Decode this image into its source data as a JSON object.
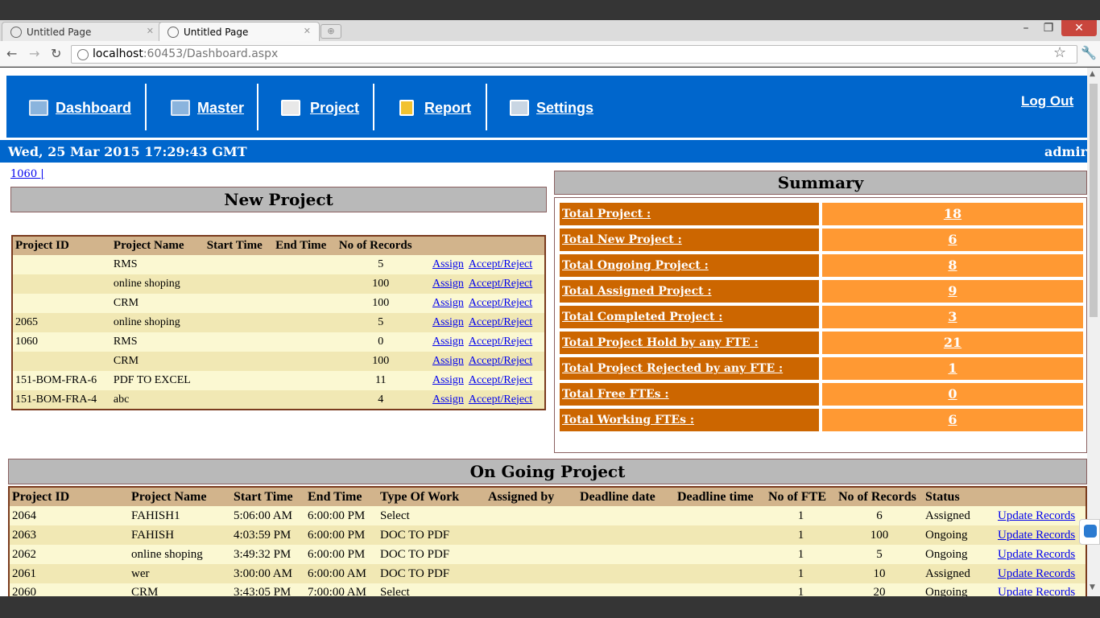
{
  "browser": {
    "tabs": [
      {
        "title": "Untitled Page",
        "active": false
      },
      {
        "title": "Untitled Page",
        "active": true
      }
    ],
    "url_host": "localhost",
    "url_rest": ":60453/Dashboard.aspx",
    "window_controls": {
      "minimize": "–",
      "restore": "❐",
      "close": "✕"
    }
  },
  "menu": {
    "items": [
      {
        "label": "Dashboard",
        "icon": "monitor-icon"
      },
      {
        "label": "Master",
        "icon": "monitor-icon"
      },
      {
        "label": "Project",
        "icon": "project-add-icon"
      },
      {
        "label": "Report",
        "icon": "bar-chart-icon"
      },
      {
        "label": "Settings",
        "icon": "gear-icon"
      }
    ],
    "logout": "Log Out"
  },
  "datebar": {
    "datetime": "Wed, 25 Mar 2015 17:29:43 GMT",
    "user": "admir"
  },
  "top_link": "1060 |",
  "new_project": {
    "title": "New Project",
    "columns": [
      "Project ID",
      "Project Name",
      "Start Time",
      "End Time",
      "No of Records",
      "",
      ""
    ],
    "rows": [
      [
        "",
        "RMS",
        "",
        "",
        "5",
        "Assign",
        "Accept/Reject"
      ],
      [
        "",
        "online shoping",
        "",
        "",
        "100",
        "Assign",
        "Accept/Reject"
      ],
      [
        "",
        "CRM",
        "",
        "",
        "100",
        "Assign",
        "Accept/Reject"
      ],
      [
        "2065",
        "online shoping",
        "",
        "",
        "5",
        "Assign",
        "Accept/Reject"
      ],
      [
        "1060",
        "RMS",
        "",
        "",
        "0",
        "Assign",
        "Accept/Reject"
      ],
      [
        "",
        "CRM",
        "",
        "",
        "100",
        "Assign",
        "Accept/Reject"
      ],
      [
        "151-BOM-FRA-6",
        "PDF TO EXCEL",
        "",
        "",
        "11",
        "Assign",
        "Accept/Reject"
      ],
      [
        "151-BOM-FRA-4",
        "abc",
        "",
        "",
        "4",
        "Assign",
        "Accept/Reject"
      ]
    ]
  },
  "summary": {
    "title": "Summary",
    "rows": [
      {
        "label": "Total Project :",
        "value": "18"
      },
      {
        "label": "Total New Project :",
        "value": "6"
      },
      {
        "label": "Total Ongoing Project :",
        "value": "8"
      },
      {
        "label": "Total Assigned Project :",
        "value": "9"
      },
      {
        "label": "Total Completed Project :",
        "value": "3"
      },
      {
        "label": "Total Project Hold by any FTE :",
        "value": "21"
      },
      {
        "label": "Total Project Rejected by any FTE :",
        "value": "1"
      },
      {
        "label": "Total Free FTEs :",
        "value": "0"
      },
      {
        "label": "Total Working FTEs :",
        "value": "6"
      }
    ]
  },
  "ongoing": {
    "title": "On Going Project",
    "columns": [
      "Project ID",
      "Project Name",
      "Start Time",
      "End Time",
      "Type Of Work",
      "Assigned by",
      "Deadline date",
      "Deadline time",
      "No of FTE",
      "No of Records",
      "Status",
      ""
    ],
    "rows": [
      [
        "2064",
        "FAHISH1",
        "5:06:00 AM",
        "6:00:00 PM",
        "Select",
        "",
        "",
        "",
        "1",
        "6",
        "Assigned",
        "Update Records"
      ],
      [
        "2063",
        "FAHISH",
        "4:03:59 PM",
        "6:00:00 PM",
        "DOC TO PDF",
        "",
        "",
        "",
        "1",
        "100",
        "Ongoing",
        "Update Records"
      ],
      [
        "2062",
        "online shoping",
        "3:49:32 PM",
        "6:00:00 PM",
        "DOC TO PDF",
        "",
        "",
        "",
        "1",
        "5",
        "Ongoing",
        "Update Records"
      ],
      [
        "2061",
        "wer",
        "3:00:00 AM",
        "6:00:00 AM",
        "DOC TO PDF",
        "",
        "",
        "",
        "1",
        "10",
        "Assigned",
        "Update Records"
      ],
      [
        "2060",
        "CRM",
        "3:43:05 PM",
        "7:00:00 AM",
        "Select",
        "",
        "",
        "",
        "1",
        "20",
        "Ongoing",
        "Update Records"
      ]
    ]
  }
}
